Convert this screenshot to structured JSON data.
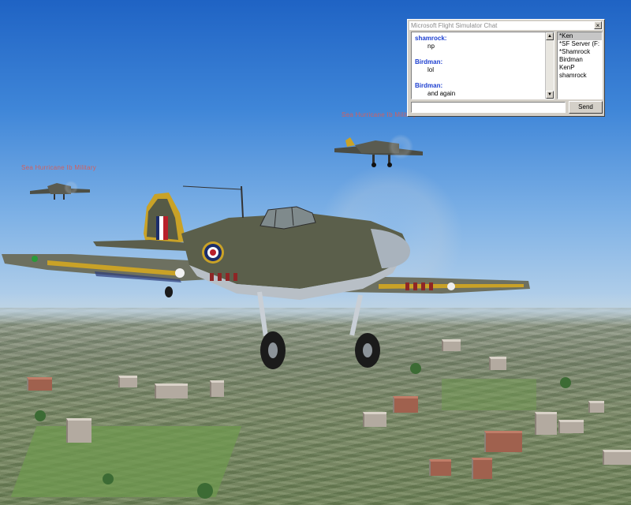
{
  "chat": {
    "title": "Microsoft Flight Simulator Chat",
    "close_glyph": "×",
    "messages": [
      {
        "sender": "shamrock:",
        "text": "np"
      },
      {
        "sender": "Birdman:",
        "text": "lol"
      },
      {
        "sender": "Birdman:",
        "text": "and again"
      }
    ],
    "users": [
      "*Ken",
      "*SF Server (F:",
      "*Shamrock",
      "Birdman",
      "KenP",
      "shamrock"
    ],
    "selected_user": "*Ken",
    "input_value": "",
    "send_label": "Send",
    "colors": {
      "sender": "#1d3fd0",
      "window": "#d4d0c8"
    }
  },
  "scene": {
    "aircraft_labels": [
      "Sea Hurricane Ib Military",
      "Sea Hurricane Ib Military"
    ]
  }
}
